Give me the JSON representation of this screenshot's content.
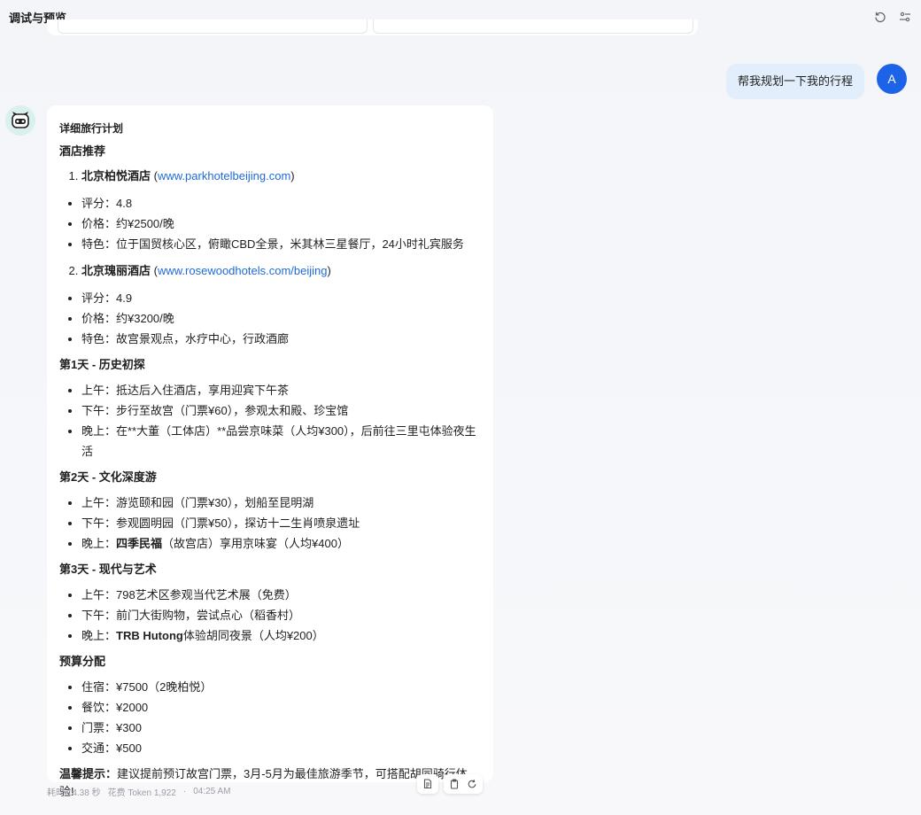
{
  "header": {
    "title": "调试与预览"
  },
  "user_message": {
    "text": "帮我规划一下我的行程",
    "avatar_letter": "A"
  },
  "reply": {
    "heading": "详细旅行计划",
    "hotel_section": "酒店推荐",
    "hotels": [
      {
        "name": "北京柏悦酒店",
        "open": "(",
        "url": "www.parkhotelbeijing.com",
        "close": ")",
        "details": [
          "评分：4.8",
          "价格：约¥2500/晚",
          "特色：位于国贸核心区，俯瞰CBD全景，米其林三星餐厅，24小时礼宾服务"
        ]
      },
      {
        "name": "北京瑰丽酒店",
        "open": "(",
        "url": "www.rosewoodhotels.com/beijing",
        "close": ")",
        "details": [
          "评分：4.9",
          "价格：约¥3200/晚",
          "特色：故宫景观点，水疗中心，行政酒廊"
        ]
      }
    ],
    "day1": {
      "title": "第1天 - 历史初探",
      "items": [
        "上午：抵达后入住酒店，享用迎宾下午茶",
        "下午：步行至故宫（门票¥60），参观太和殿、珍宝馆",
        "晚上：在**大董（工体店）**品尝京味菜（人均¥300），后前往三里屯体验夜生活"
      ]
    },
    "day2": {
      "title": "第2天 - 文化深度游",
      "items": [
        "上午：游览颐和园（门票¥30），划船至昆明湖",
        "下午：参观圆明园（门票¥50），探访十二生肖喷泉遗址"
      ],
      "evening_prefix": "晚上：",
      "evening_bold": "四季民福",
      "evening_rest": "（故宫店）享用京味宴（人均¥400）"
    },
    "day3": {
      "title": "第3天 - 现代与艺术",
      "items": [
        "上午：798艺术区参观当代艺术展（免费）",
        "下午：前门大街购物，尝试点心（稻香村）"
      ],
      "evening_prefix": "晚上：",
      "evening_bold": "TRB Hutong",
      "evening_rest": "体验胡同夜景（人均¥200）"
    },
    "budget": {
      "title": "预算分配",
      "items": [
        "住宿：¥7500（2晚柏悦）",
        "餐饮：¥2000",
        "门票：¥300",
        "交通：¥500"
      ]
    },
    "tip_label": "温馨提示：",
    "tip_text": "建议提前预订故宫门票，3月-5月为最佳旅游季节，可搭配胡同骑行体验!"
  },
  "meta": {
    "elapsed": "耗时 14.38 秒",
    "tokens": "花费 Token 1,922",
    "separator": "·",
    "time": "04:25 AM"
  }
}
